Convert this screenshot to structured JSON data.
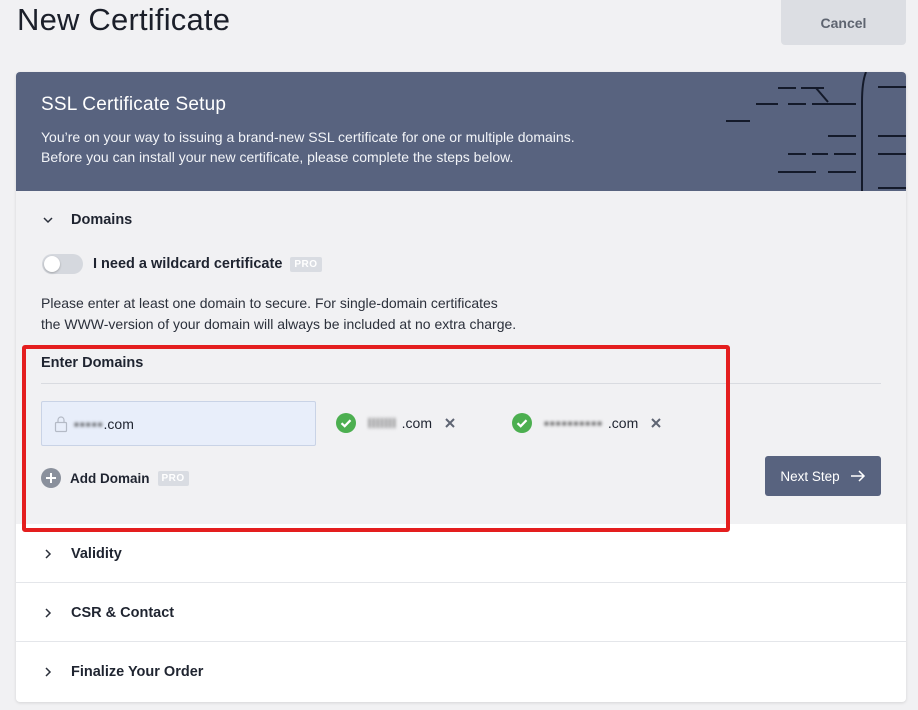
{
  "page": {
    "title": "New Certificate",
    "cancel_label": "Cancel"
  },
  "banner": {
    "title": "SSL Certificate Setup",
    "line1": "You’re on your way to issuing a brand-new SSL certificate for one or multiple domains.",
    "line2": "Before you can install your new certificate, please complete the steps below."
  },
  "domains": {
    "section_label": "Domains",
    "wildcard_label": "I need a wildcard certificate",
    "wildcard_enabled": false,
    "pro_label": "PRO",
    "help_line1": "Please enter at least one domain to secure. For single-domain certificates",
    "help_line2": "the WWW-version of your domain will always be included at no extra charge.",
    "enter_label": "Enter Domains",
    "input_obscured": "•••••",
    "input_suffix": ".com",
    "chips": [
      {
        "obscured": "lllllll  ",
        "suffix": ".com"
      },
      {
        "obscured": "••••••••••  ",
        "suffix": ".com"
      }
    ],
    "add_label": "Add Domain",
    "add_pro_label": "PRO",
    "next_label": "Next Step"
  },
  "steps": [
    {
      "label": "Validity"
    },
    {
      "label": "CSR & Contact"
    },
    {
      "label": "Finalize Your Order"
    }
  ],
  "colors": {
    "banner": "#58637f",
    "success": "#4caf50",
    "highlight": "#e41e1e"
  }
}
